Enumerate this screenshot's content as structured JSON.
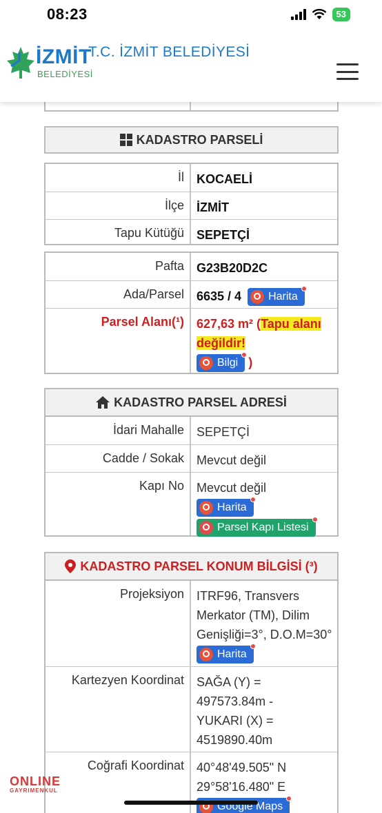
{
  "status": {
    "time": "08:23",
    "battery": "53"
  },
  "header": {
    "logo_main": "İZMİT",
    "logo_sub": "BELEDİYESİ",
    "logo_dot": ".",
    "title": "T.C. İZMİT BELEDİYESİ"
  },
  "parcel": {
    "title": "KADASTRO PARSELİ",
    "il_label": "İl",
    "il_value": "KOCAELİ",
    "ilce_label": "İlçe",
    "ilce_value": "İZMİT",
    "tapu_label": "Tapu Kütüğü",
    "tapu_value": "SEPETÇİ",
    "pafta_label": "Pafta",
    "pafta_value": "G23B20D2C",
    "ada_label": "Ada/Parsel",
    "ada_value": "6635 / 4",
    "harita_btn": "Harita",
    "alan_label": "Parsel Alanı(¹)",
    "alan_value": "627,63 m² (",
    "alan_note": "Tapu alanı değildir!",
    "bilgi_btn": "Bilgi",
    "close_paren": ")"
  },
  "address": {
    "title": "KADASTRO PARSEL ADRESİ",
    "mahalle_label": "İdari Mahalle",
    "mahalle_value": "SEPETÇİ",
    "cadde_label": "Cadde / Sokak",
    "cadde_value": "Mevcut değil",
    "kapi_label": "Kapı No",
    "kapi_value": "Mevcut değil",
    "harita_btn": "Harita",
    "kapi_list_btn": "Parsel Kapı Listesi"
  },
  "location": {
    "title": "KADASTRO PARSEL KONUM BİLGİSİ (³)",
    "proj_label": "Projeksiyon",
    "proj_value": "ITRF96, Transvers Merkator (TM), Dilim Genişliği=3°, D.O.M=30°",
    "harita_btn": "Harita",
    "kart_label": "Kartezyen Koordinat",
    "kart_line1": "SAĞA (Y) =",
    "kart_line2": "497573.84m -",
    "kart_line3": "YUKARI (X) =",
    "kart_line4": "4519890.40m",
    "cog_label": "Coğrafi Koordinat",
    "cog_line1": "40°48'49.505\" N",
    "cog_line2": "29°58'16.480\" E",
    "gmaps_btn": "Google Maps"
  },
  "watermark": {
    "top": "ONLINE",
    "bottom": "GAYRIMENKUL"
  }
}
